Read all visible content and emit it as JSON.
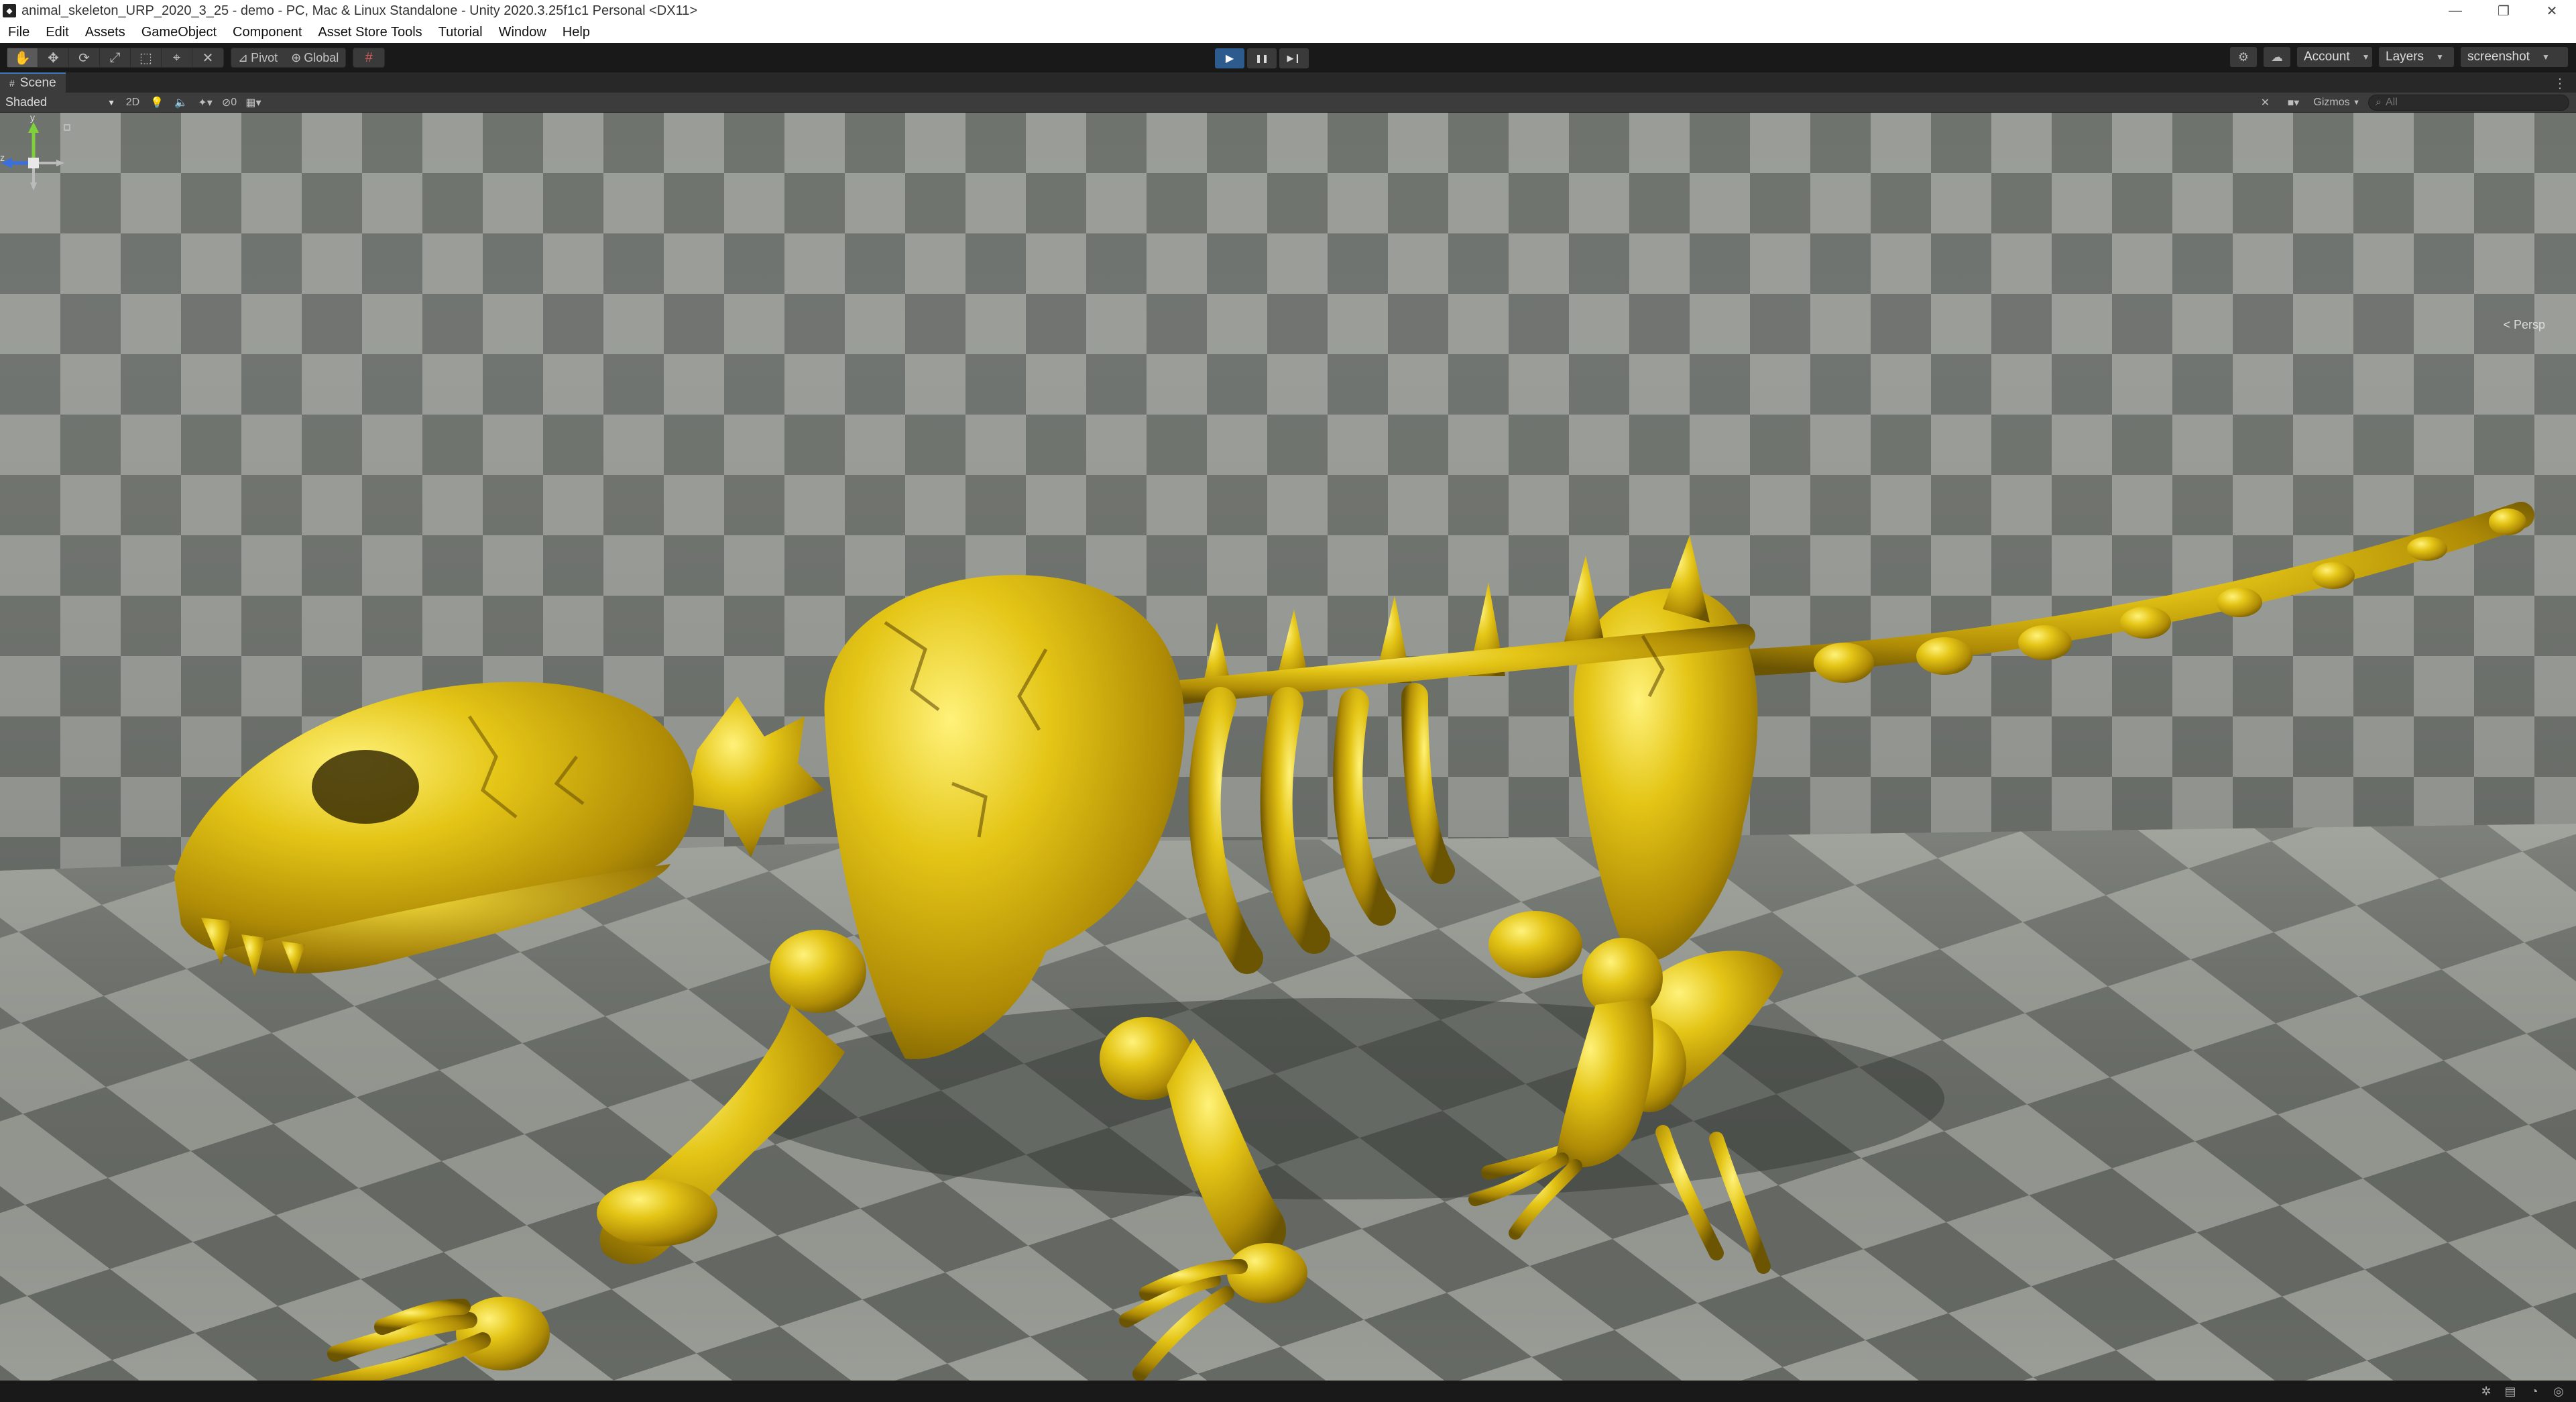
{
  "window": {
    "title": "animal_skeleton_URP_2020_3_25 - demo - PC, Mac & Linux Standalone - Unity 2020.3.25f1c1 Personal <DX11>",
    "app_icon": "unity-icon",
    "minimize_icon": "minimize-icon",
    "maximize_icon": "restore-icon",
    "close_icon": "close-icon"
  },
  "menu": {
    "items": [
      "File",
      "Edit",
      "Assets",
      "GameObject",
      "Component",
      "Asset Store Tools",
      "Tutorial",
      "Window",
      "Help"
    ]
  },
  "toolbar": {
    "tools": [
      {
        "name": "hand-tool-icon",
        "glyph": "✋"
      },
      {
        "name": "move-tool-icon",
        "glyph": "✥"
      },
      {
        "name": "rotate-tool-icon",
        "glyph": "⟳"
      },
      {
        "name": "scale-tool-icon",
        "glyph": "⤢"
      },
      {
        "name": "rect-tool-icon",
        "glyph": "⬚"
      },
      {
        "name": "transform-tool-icon",
        "glyph": "⌖"
      },
      {
        "name": "custom-tool-icon",
        "glyph": "✕"
      }
    ],
    "pivot_label": "Pivot",
    "global_label": "Global",
    "grid_snap_icon": "grid-snap-icon",
    "play_icon": "▶",
    "pause_icon": "❚❚",
    "step_icon": "▶❙",
    "collab_icon": "cloud-icon",
    "services_icon": "services-icon",
    "account_label": "Account",
    "layers_label": "Layers",
    "layout_label": "screenshot"
  },
  "scene": {
    "tab_label": "Scene",
    "shading_mode": "Shaded",
    "mode_2d_label": "2D",
    "hidden_count": "0",
    "gizmos_label": "Gizmos",
    "search_placeholder": "All",
    "projection_label": "< Persp",
    "axis_y": "y",
    "axis_z": "z",
    "ground_color": "#8b8e89",
    "skeleton_color": "#d8bd14"
  },
  "status": {
    "icons": [
      "bug-icon",
      "cache-icon",
      "progress-icon",
      "auto-refresh-icon"
    ]
  }
}
